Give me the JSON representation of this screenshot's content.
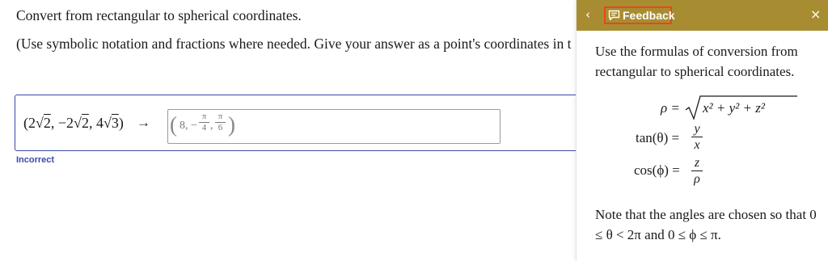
{
  "question": {
    "title": "Convert from rectangular to spherical coordinates.",
    "instructions": "(Use symbolic notation and fractions where needed. Give your answer as a point's coordinates in t",
    "given_point": {
      "open": "(2",
      "r1": "2",
      "sep1": ", −2",
      "r2": "2",
      "sep2": ", 4",
      "r3": "3",
      "close": ")"
    },
    "arrow": "→",
    "answer": {
      "open_paren": "(",
      "value": "8, −",
      "frac1_num": "π",
      "frac1_den": "4",
      "sep": ",",
      "frac2_num": "π",
      "frac2_den": "6",
      "close_paren": ")"
    },
    "status": "Incorrect"
  },
  "feedback": {
    "back_glyph": "‹",
    "tab_label": "Feedback",
    "close_glyph": "×",
    "intro": "Use the formulas of conversion from rectangular to spherical coordinates.",
    "formulas": {
      "rho_lhs": "ρ =",
      "rho_rhs": "x² + y² + z²",
      "tan_lhs": "tan(θ) =",
      "tan_num": "y",
      "tan_den": "x",
      "cos_lhs": "cos(ϕ) =",
      "cos_num": "z",
      "cos_den": "ρ"
    },
    "note": "Note that the angles are chosen so that 0 ≤ θ < 2π and 0 ≤ ϕ ≤ π."
  },
  "colors": {
    "header_bg": "#a88c31",
    "tab_border": "#e34a1f",
    "accent_blue": "#3949ab"
  },
  "icons": {
    "feedback_tab": "comment-icon",
    "back": "chevron-left-icon",
    "close": "close-icon"
  }
}
